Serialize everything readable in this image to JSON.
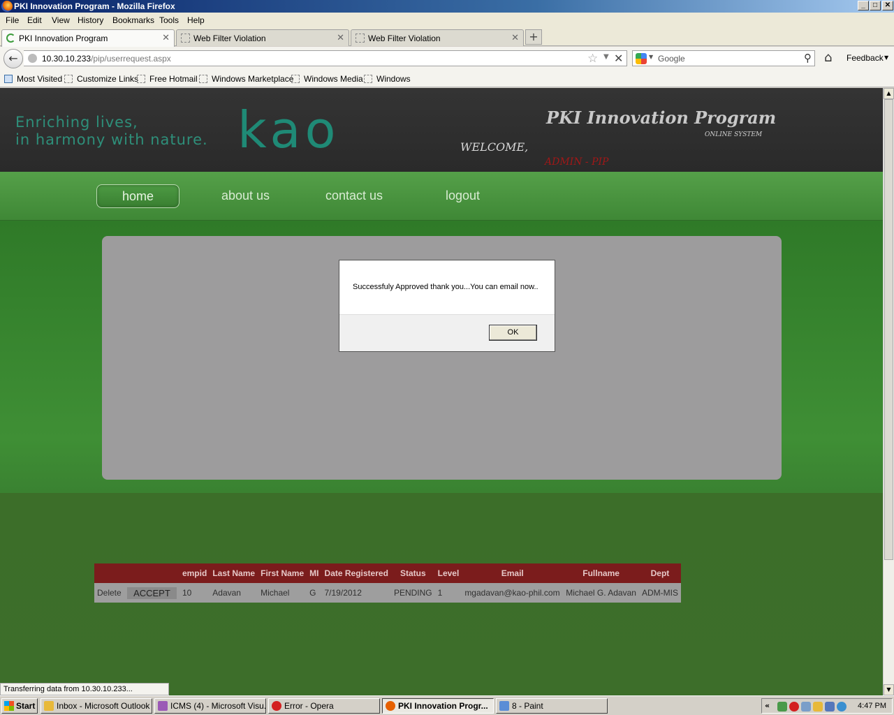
{
  "window": {
    "title": "PKI Innovation Program - Mozilla Firefox",
    "controls": [
      "_",
      "□",
      "✕"
    ]
  },
  "menu": [
    "File",
    "Edit",
    "View",
    "History",
    "Bookmarks",
    "Tools",
    "Help"
  ],
  "tabs": [
    {
      "label": "PKI Innovation Program",
      "active": true
    },
    {
      "label": "Web Filter Violation",
      "active": false
    },
    {
      "label": "Web Filter Violation",
      "active": false
    }
  ],
  "newtab_label": "+",
  "address": {
    "host": "10.30.10.233",
    "path": "/pip/userrequest.aspx"
  },
  "search": {
    "placeholder": "Google"
  },
  "feedback_label": "Feedback",
  "bookmarks": [
    "Most Visited",
    "Customize Links",
    "Free Hotmail",
    "Windows Marketplace",
    "Windows Media",
    "Windows"
  ],
  "site": {
    "tagline_line1": "Enriching lives,",
    "tagline_line2": "in harmony with nature.",
    "logo_text": "kao",
    "program_title": "PKI Innovation Program",
    "subtitle": "ONLINE SYSTEM",
    "welcome": "WELCOME,",
    "user": "ADMIN - PIP",
    "nav": [
      "home",
      "about us",
      "contact us",
      "logout"
    ]
  },
  "dialog": {
    "message": "Successfuly Approved thank you...You can email now..",
    "ok_label": "OK"
  },
  "table": {
    "headers": [
      "",
      "",
      "empid",
      "Last Name",
      "First Name",
      "MI",
      "Date Registered",
      "Status",
      "Level",
      "Email",
      "Fullname",
      "Dept"
    ],
    "rows": [
      {
        "delete": "Delete",
        "accept": "ACCEPT",
        "empid": "10",
        "last_name": "Adavan",
        "first_name": "Michael",
        "mi": "G",
        "date_registered": "7/19/2012",
        "status": "PENDING",
        "level": "1",
        "email": "mgadavan@kao-phil.com",
        "fullname": "Michael G. Adavan",
        "dept": "ADM-MIS"
      }
    ]
  },
  "status_text": "Transferring data from 10.30.10.233...",
  "taskbar": {
    "start": "Start",
    "tasks": [
      {
        "label": "Inbox - Microsoft Outlook",
        "color": "#e8b93a"
      },
      {
        "label": "ICMS (4) - Microsoft Visu...",
        "color": "#9b59b6"
      },
      {
        "label": "Error - Opera",
        "color": "#d32020"
      },
      {
        "label": "PKI Innovation Progr...",
        "color": "#e66000",
        "active": true
      },
      {
        "label": "8 - Paint",
        "color": "#5b8dd6"
      }
    ],
    "tray_arrow": "«",
    "clock": "4:47 PM"
  },
  "colors": {
    "header_bg": "#2f2f2f",
    "nav_green": "#4a9440",
    "table_header": "#7b1c1c",
    "accent_teal": "#1f8a76",
    "admin_red": "#a01818"
  }
}
